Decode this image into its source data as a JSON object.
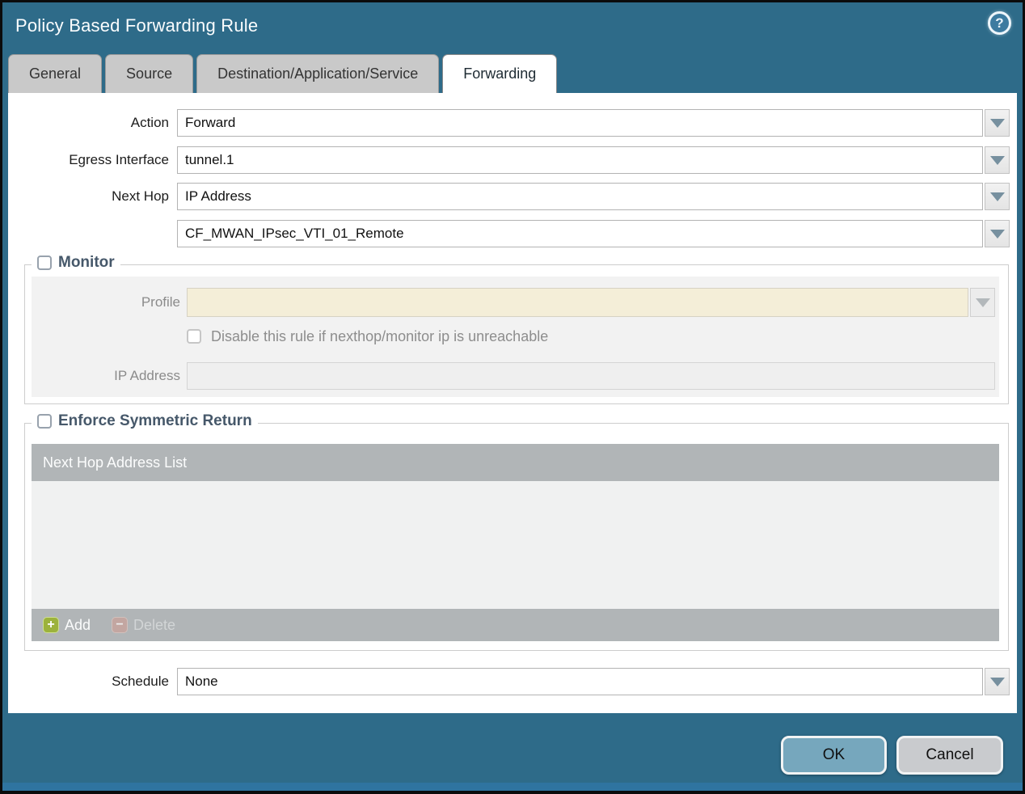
{
  "window": {
    "title": "Policy Based Forwarding Rule",
    "help_glyph": "?"
  },
  "tabs": [
    {
      "label": "General",
      "active": false
    },
    {
      "label": "Source",
      "active": false
    },
    {
      "label": "Destination/Application/Service",
      "active": false
    },
    {
      "label": "Forwarding",
      "active": true
    }
  ],
  "form": {
    "action_label": "Action",
    "action_value": "Forward",
    "egress_label": "Egress Interface",
    "egress_value": "tunnel.1",
    "next_hop_label": "Next Hop",
    "next_hop_value": "IP Address",
    "next_hop_address_value": "CF_MWAN_IPsec_VTI_01_Remote",
    "schedule_label": "Schedule",
    "schedule_value": "None"
  },
  "monitor": {
    "title": "Monitor",
    "checked": false,
    "profile_label": "Profile",
    "profile_value": "",
    "disable_rule_label": "Disable this rule if nexthop/monitor ip is unreachable",
    "disable_rule_checked": false,
    "ip_address_label": "IP Address",
    "ip_address_value": ""
  },
  "symmetric": {
    "title": "Enforce Symmetric Return",
    "checked": false,
    "table_header": "Next Hop Address List",
    "rows": [],
    "add_label": "Add",
    "add_glyph": "+",
    "delete_label": "Delete",
    "delete_glyph": "−"
  },
  "footer": {
    "ok_label": "OK",
    "cancel_label": "Cancel"
  },
  "colors": {
    "titlebar_teal": "#2e6b89",
    "active_tab_bg": "#ffffff",
    "inactive_tab_bg": "#c9c9c9",
    "table_header_gray": "#b1b5b7",
    "profile_disabled_cream": "#f4eed8",
    "ok_button_blue": "#76a7bd",
    "cancel_button_gray": "#c9cbce",
    "add_icon_green": "#9cb23c"
  }
}
